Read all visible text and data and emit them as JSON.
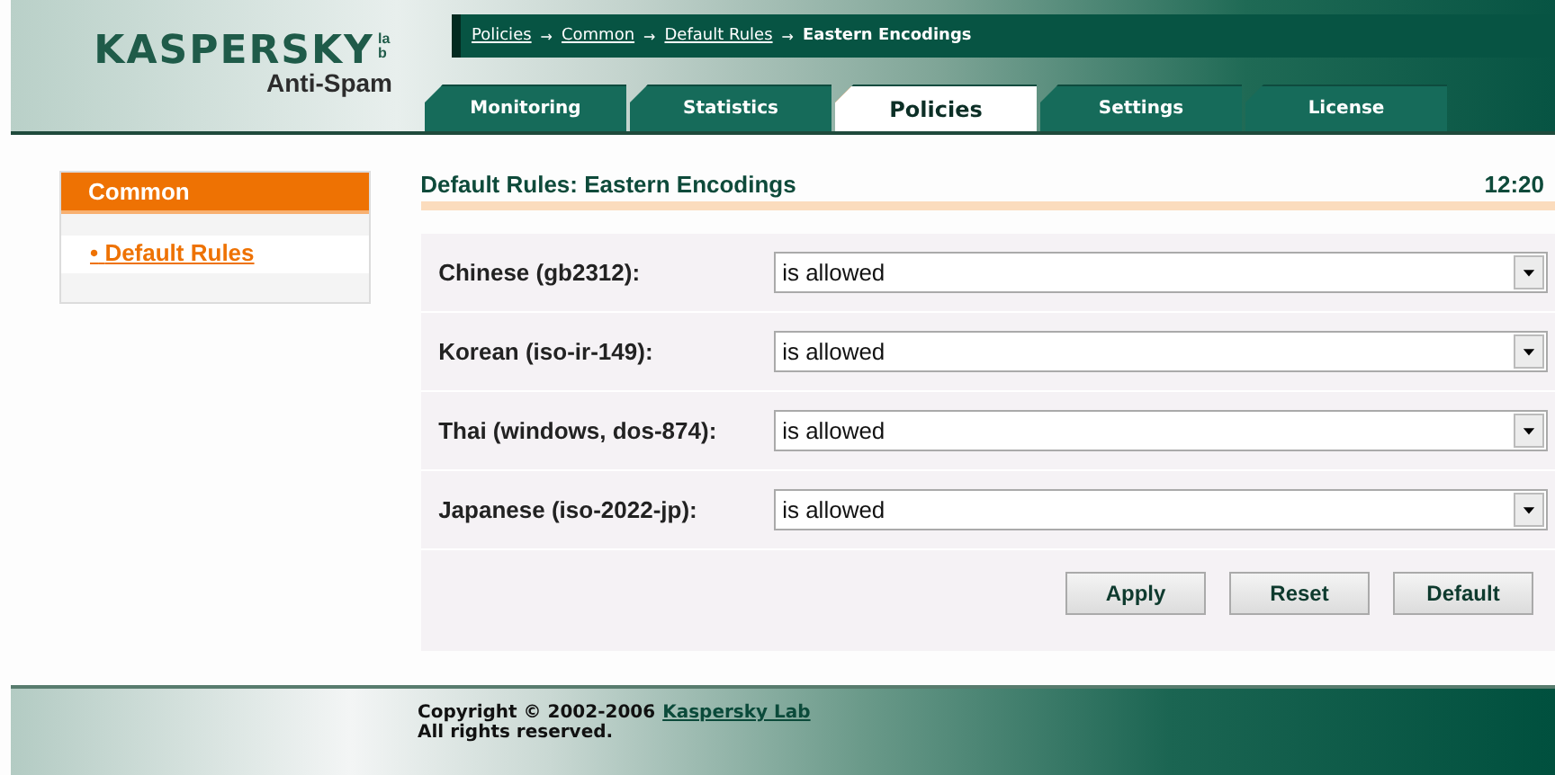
{
  "logo": {
    "wordmark": "KASPERSKY",
    "lab": "lab",
    "product": "Anti-Spam"
  },
  "breadcrumb": {
    "links": [
      "Policies",
      "Common",
      "Default Rules"
    ],
    "separator": "→",
    "current": "Eastern Encodings"
  },
  "tabs": [
    {
      "label": "Monitoring",
      "selected": false
    },
    {
      "label": "Statistics",
      "selected": false
    },
    {
      "label": "Policies",
      "selected": true
    },
    {
      "label": "Settings",
      "selected": false
    },
    {
      "label": "License",
      "selected": false
    }
  ],
  "sidebar": {
    "title": "Common",
    "items": [
      {
        "label": "Default Rules",
        "bullet": "•"
      }
    ]
  },
  "page": {
    "title": "Default Rules: Eastern Encodings",
    "time": "12:20"
  },
  "rules": [
    {
      "label": "Chinese (gb2312):",
      "value": "is allowed"
    },
    {
      "label": "Korean (iso-ir-149):",
      "value": "is allowed"
    },
    {
      "label": "Thai (windows, dos-874):",
      "value": "is allowed"
    },
    {
      "label": "Japanese (iso-2022-jp):",
      "value": "is allowed"
    }
  ],
  "buttons": [
    "Apply",
    "Reset",
    "Default"
  ],
  "footer": {
    "copyright": "Copyright © 2002-2006",
    "link": "Kaspersky Lab",
    "rights": "All rights reserved."
  }
}
